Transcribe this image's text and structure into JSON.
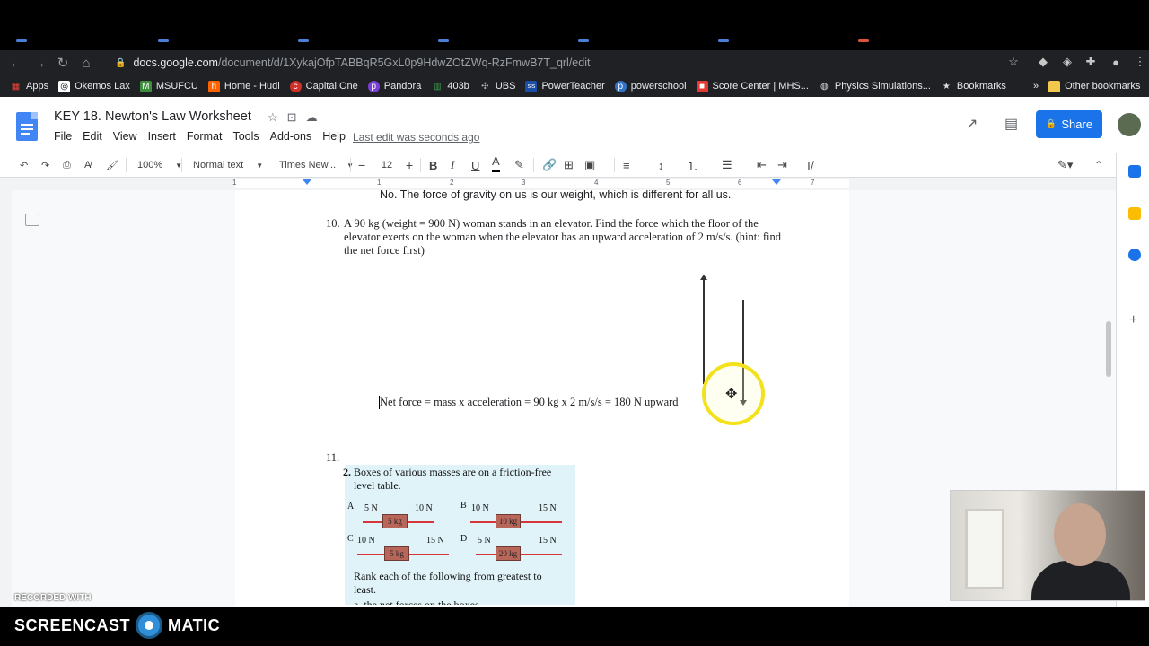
{
  "browser": {
    "url_host": "docs.google.com",
    "url_path": "/document/d/1XykajOfpTABBqR5GxL0p9HdwZOtZWq-RzFmwB7T_qrl/edit",
    "bookmarks": [
      {
        "label": "Apps",
        "icon": "apps-grid-icon",
        "color": "#ea4335"
      },
      {
        "label": "Okemos Lax",
        "icon": "lax-icon",
        "color": "#ffffff"
      },
      {
        "label": "MSUFCU",
        "icon": "msufcu-icon",
        "color": "#3e8e3e"
      },
      {
        "label": "Home - Hudl",
        "icon": "hudl-icon",
        "color": "#ff6300"
      },
      {
        "label": "Capital One",
        "icon": "capital-one-icon",
        "color": "#d03027"
      },
      {
        "label": "Pandora",
        "icon": "pandora-icon",
        "color": "#7a3fd6"
      },
      {
        "label": "403b",
        "icon": "chart-icon",
        "color": "#3ca24a"
      },
      {
        "label": "UBS",
        "icon": "ubs-icon",
        "color": "#444444"
      },
      {
        "label": "PowerTeacher",
        "icon": "sis-icon",
        "color": "#1a4ea8"
      },
      {
        "label": "powerschool",
        "icon": "powerschool-icon",
        "color": "#3173c6"
      },
      {
        "label": "Score Center | MHS...",
        "icon": "score-icon",
        "color": "#e53935"
      },
      {
        "label": "Physics Simulations...",
        "icon": "globe-icon",
        "color": "#dddddd"
      },
      {
        "label": "Bookmarks",
        "icon": "star-icon",
        "color": "#dddddd"
      }
    ],
    "other_bookmarks": "Other bookmarks",
    "more": "»"
  },
  "doc": {
    "title": "KEY 18. Newton's Law Worksheet",
    "menus": [
      "File",
      "Edit",
      "View",
      "Insert",
      "Format",
      "Tools",
      "Add-ons",
      "Help"
    ],
    "last_edit": "Last edit was seconds ago",
    "share": "Share"
  },
  "toolbar": {
    "zoom": "100%",
    "style": "Normal text",
    "font": "Times New...",
    "size": "12"
  },
  "ruler": [
    "1",
    "1",
    "2",
    "3",
    "4",
    "5",
    "6",
    "7"
  ],
  "content": {
    "line_top": "No. The force of gravity on us is our weight, which is different for all us.",
    "q10_num": "10.",
    "q10_text": "A 90 kg (weight = 900 N) woman stands in an elevator. Find the force which the floor of the elevator exerts on the woman when the elevator has an upward acceleration of 2 m/s/s. (hint: find the net force first)",
    "net_force": "Net force = mass x acceleration = 90 kg x 2 m/s/s = 180 N upward",
    "q11_num": "11.",
    "img": {
      "heading_num": "2.",
      "heading": "Boxes of various masses are on a friction-free level table.",
      "a_label": "A",
      "a_left": "5 N",
      "a_right": "10 N",
      "a_box": "5 kg",
      "b_label": "B",
      "b_left": "10 N",
      "b_right": "15 N",
      "b_box": "10 kg",
      "c_label": "C",
      "c_left": "10 N",
      "c_right": "15 N",
      "c_box": "5 kg",
      "d_label": "D",
      "d_left": "5 N",
      "d_right": "15 N",
      "d_box": "20 kg",
      "rank": "Rank each of the following from greatest to least.",
      "sub_a": "a. the net forces on the boxes"
    }
  },
  "overlay": {
    "recorded_with": "RECORDED WITH",
    "brand_left": "SCREENCAST",
    "brand_right": "MATIC"
  }
}
